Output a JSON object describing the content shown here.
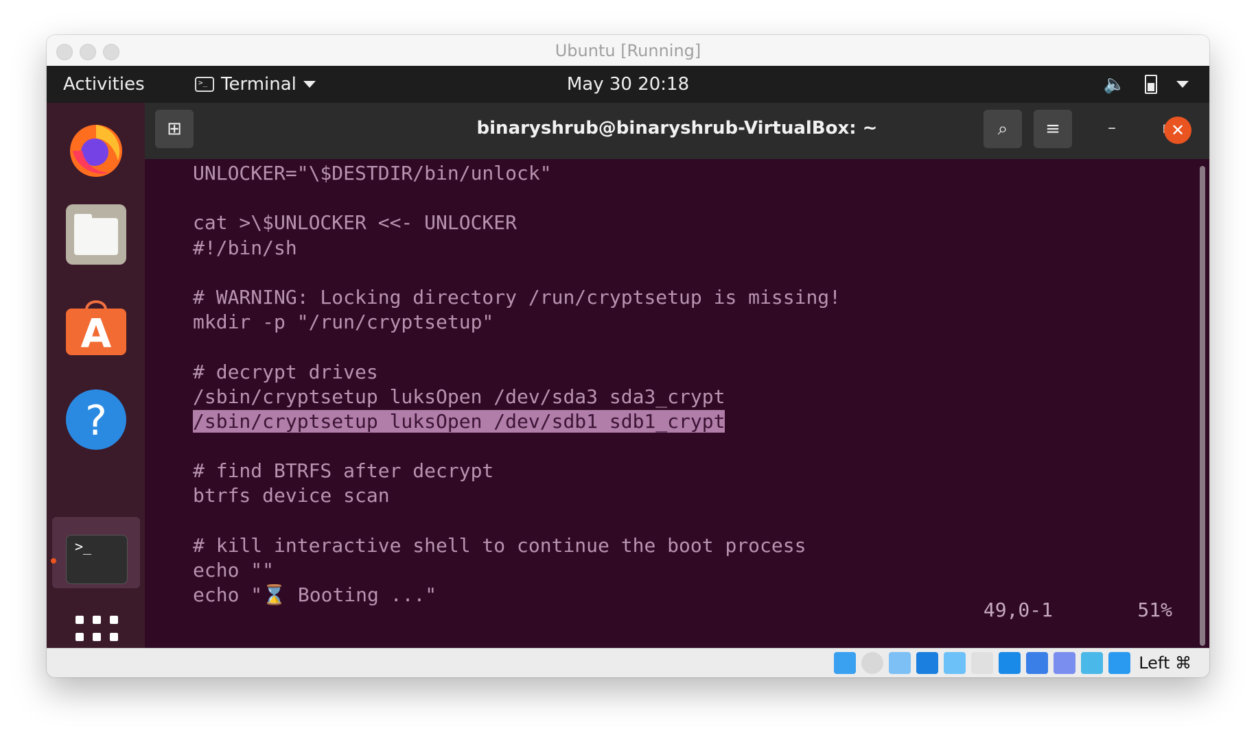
{
  "window": {
    "title": "Ubuntu [Running]"
  },
  "top_panel": {
    "activities": "Activities",
    "app_menu": "Terminal",
    "clock": "May 30  20:18",
    "tray_icons": [
      "volume-icon",
      "battery-icon",
      "system-menu-caret-icon"
    ]
  },
  "dock": {
    "items": [
      "firefox",
      "files",
      "ubuntu-software",
      "help",
      "terminal",
      "show-applications"
    ],
    "active": "terminal"
  },
  "terminal": {
    "title": "binaryshrub@binaryshrub-VirtualBox: ~",
    "lines": [
      "UNLOCKER=\"\\$DESTDIR/bin/unlock\"",
      "",
      "cat >\\$UNLOCKER <<- UNLOCKER",
      "#!/bin/sh",
      "",
      "# WARNING: Locking directory /run/cryptsetup is missing!",
      "mkdir -p \"/run/cryptsetup\"",
      "",
      "# decrypt drives",
      "/sbin/cryptsetup luksOpen /dev/sda3 sda3_crypt",
      "/sbin/cryptsetup luksOpen /dev/sdb1 sdb1_crypt",
      "",
      "# find BTRFS after decrypt",
      "btrfs device scan",
      "",
      "# kill interactive shell to continue the boot process",
      "echo \"\"",
      "echo \"⌛ Booting ...\""
    ],
    "highlighted_line": 10,
    "cursor_position": "49,0-1",
    "scroll_percent": "51%"
  },
  "statusbar": {
    "icons": [
      "hard-disk-icon",
      "optical-disk-icon",
      "audio-icon",
      "network-icon",
      "usb-icon",
      "shared-folder-icon",
      "display-icon",
      "recording-icon",
      "cpu-vt-icon",
      "mouse-integration-icon",
      "download-icon"
    ],
    "host_key": "Left ⌘"
  },
  "colors": {
    "terminal_bg": "#300a24",
    "highlight": "#b07ea8",
    "accent": "#e95420"
  }
}
